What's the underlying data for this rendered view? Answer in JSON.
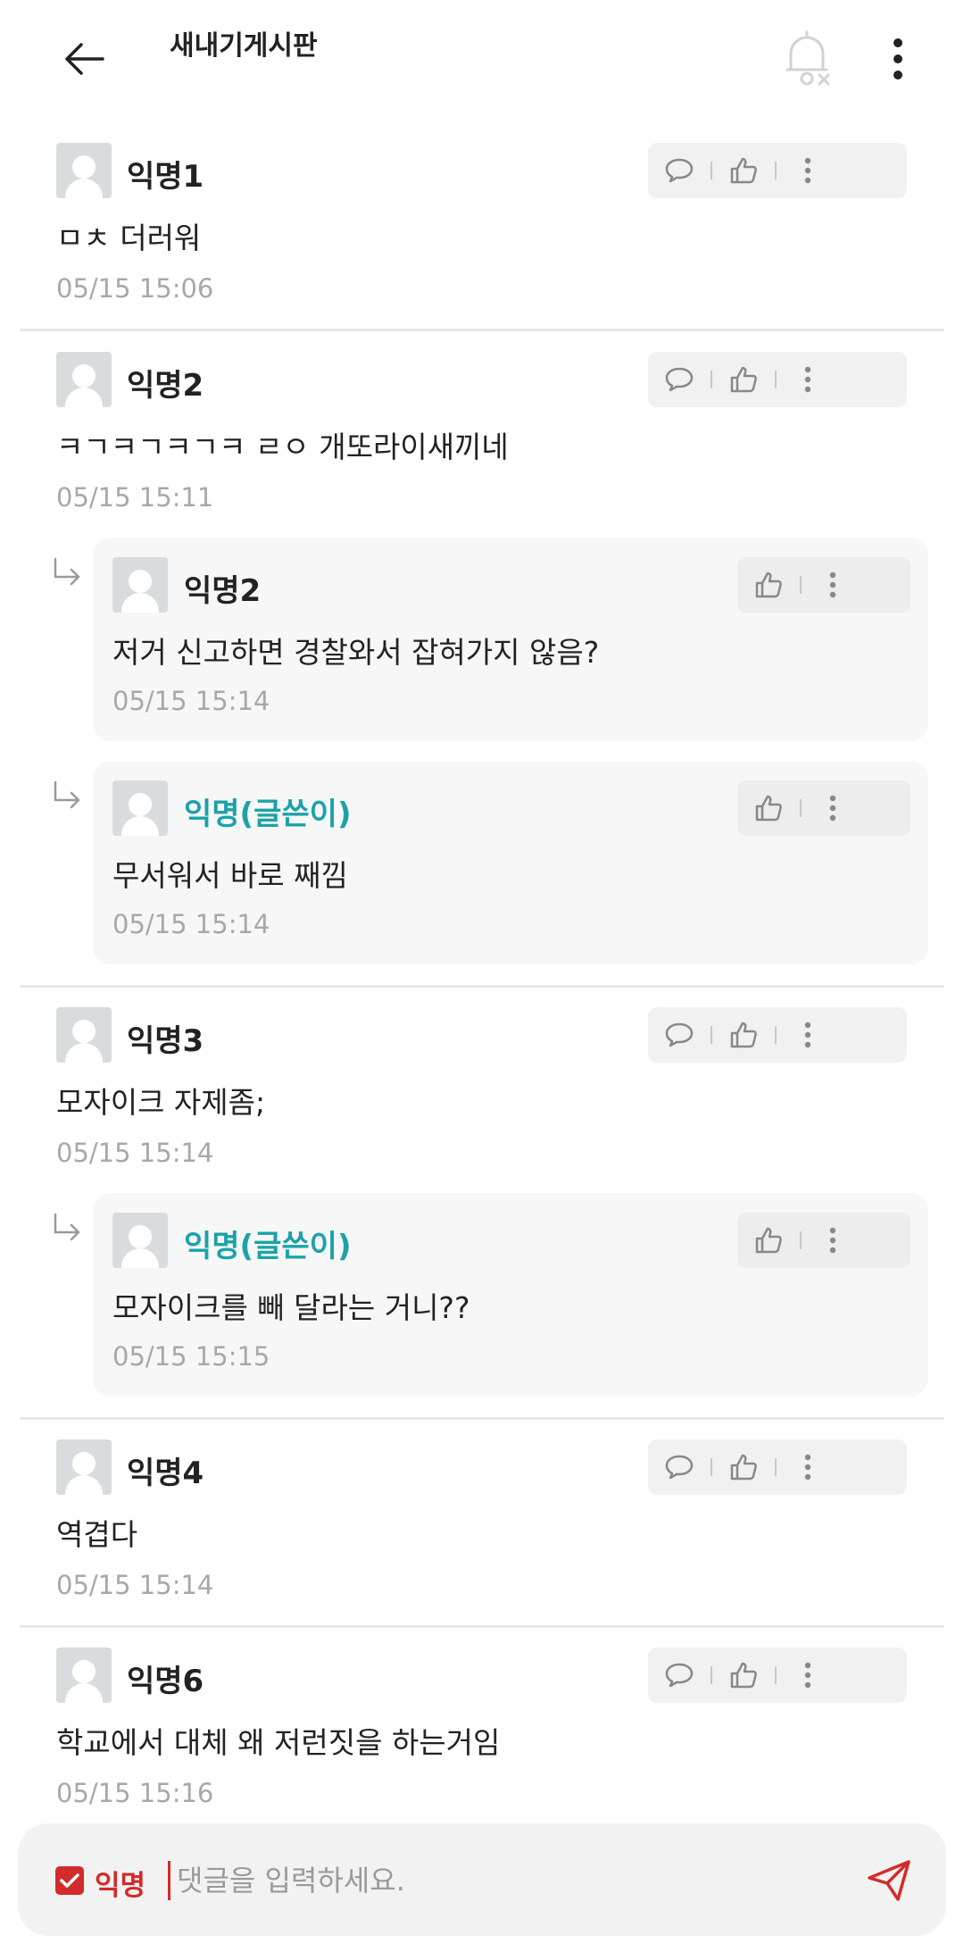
{
  "header": {
    "title": "새내기게시판"
  },
  "comments": [
    {
      "author": "익명1",
      "text": "ㅁㅊ 더러워",
      "time": "05/15 15:06"
    },
    {
      "author": "익명2",
      "text": "ㅋㄱㅋㄱㅋㄱㅋ ㄹㅇ 개또라이새끼네",
      "time": "05/15 15:11"
    },
    {
      "author": "익명2",
      "text": "저거 신고하면 경찰와서 잡혀가지 않음?",
      "time": "05/15 15:14"
    },
    {
      "author": "익명(글쓴이)",
      "text": "무서워서 바로 째낌",
      "time": "05/15 15:14"
    },
    {
      "author": "익명3",
      "text": "모자이크 자제좀;",
      "time": "05/15 15:14"
    },
    {
      "author": "익명(글쓴이)",
      "text": "모자이크를 빼 달라는 거니??",
      "time": "05/15 15:15"
    },
    {
      "author": "익명4",
      "text": "역겹다",
      "time": "05/15 15:14"
    },
    {
      "author": "익명6",
      "text": "학교에서 대체 왜 저런짓을 하는거임",
      "time": "05/15 15:16"
    }
  ],
  "input": {
    "anon_label": "익명",
    "anon_checked": true,
    "placeholder": "댓글을 입력하세요."
  },
  "colors": {
    "accent": "#d22b2b",
    "op_author": "#1aa3a8",
    "timestamp": "#a8a8a8"
  },
  "icons": [
    "back-arrow-icon",
    "notification-off-icon",
    "more-vertical-icon",
    "reply-icon",
    "like-icon",
    "reply-arrow-icon",
    "checkbox-icon",
    "send-icon"
  ]
}
